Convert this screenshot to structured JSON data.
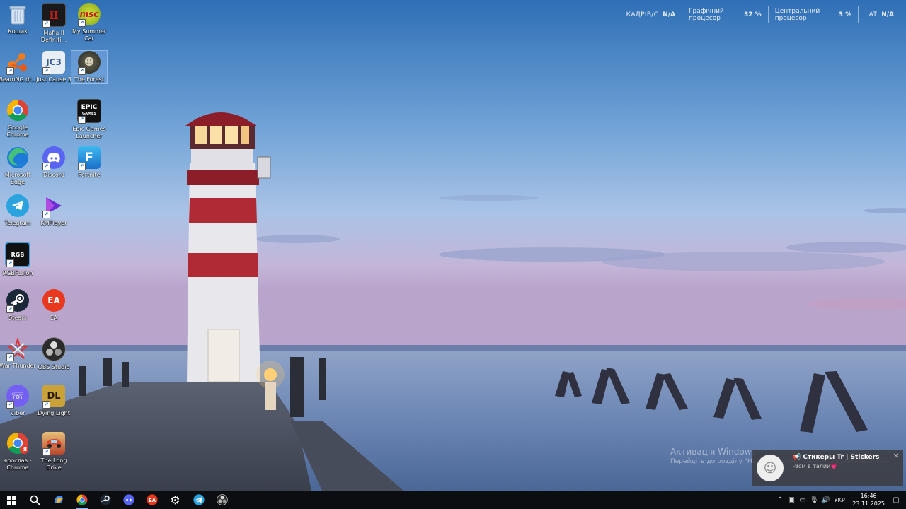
{
  "overlay": {
    "fps_label": "КАДРІВ/С",
    "fps_value": "N/A",
    "gpu_label": "Графічний процесор",
    "gpu_value": "32 %",
    "cpu_label": "Центральний процесор",
    "cpu_value": "3 %",
    "lat_label": "LAT",
    "lat_value": "N/A"
  },
  "desktop_icons": [
    {
      "label": "Кошик",
      "icon": "recycle-bin-icon"
    },
    {
      "label": "Mafia II Definiti...",
      "icon": "mafia-icon"
    },
    {
      "label": "My Summer Car",
      "icon": "msc-icon"
    },
    {
      "label": "BeamNG.dr...",
      "icon": "beamng-icon"
    },
    {
      "label": "Just Cause 3",
      "icon": "jc3-icon"
    },
    {
      "label": "The Forest",
      "icon": "the-forest-icon"
    },
    {
      "label": "Google Chrome",
      "icon": "chrome-icon"
    },
    {
      "label": "Epic Games Launcher",
      "icon": "epic-games-icon"
    },
    {
      "label": "Microsoft Edge",
      "icon": "edge-icon"
    },
    {
      "label": "Discord",
      "icon": "discord-icon"
    },
    {
      "label": "Fortnite",
      "icon": "fortnite-icon"
    },
    {
      "label": "Telegram",
      "icon": "telegram-icon"
    },
    {
      "label": "KMPlayer",
      "icon": "kmplayer-icon"
    },
    {
      "label": "RGBFusion",
      "icon": "rgbfusion-icon"
    },
    {
      "label": "Steam",
      "icon": "steam-icon"
    },
    {
      "label": "EA",
      "icon": "ea-icon"
    },
    {
      "label": "War Thunder",
      "icon": "war-thunder-icon"
    },
    {
      "label": "OBS Studio",
      "icon": "obs-icon"
    },
    {
      "label": "Viber",
      "icon": "viber-icon"
    },
    {
      "label": "Dying Light",
      "icon": "dying-light-icon"
    },
    {
      "label": "ярослав - Chrome",
      "icon": "chrome-profile-icon"
    },
    {
      "label": "The Long Drive",
      "icon": "the-long-drive-icon"
    }
  ],
  "icon_text": {
    "epic": "EPIC",
    "epic_sub": "GAMES",
    "jc3": "JC3",
    "msc": "msc",
    "fortnite": "F",
    "ea": "EA",
    "rgb": "RGB",
    "dl": "DL",
    "ya": "Я"
  },
  "activation": {
    "title": "Активація Windows",
    "subtitle": "Перейдіть до розділу \"Налаштування\", щоб активувати Windows."
  },
  "toast": {
    "title": "📢 Стикеры Tr | Stickers",
    "body": "-8см в талии💗"
  },
  "taskbar": {
    "apps": [
      "start-icon",
      "search-icon",
      "copilot-icon",
      "chrome-icon",
      "steam-icon",
      "discord-icon",
      "ea-icon",
      "settings-icon",
      "telegram-icon",
      "obs-icon"
    ]
  },
  "tray": {
    "language": "УКР",
    "time": "16:46",
    "date": "23.11.2025"
  },
  "colors": {
    "taskbar": "#0c0d10",
    "accent": "#8ab4f8"
  }
}
